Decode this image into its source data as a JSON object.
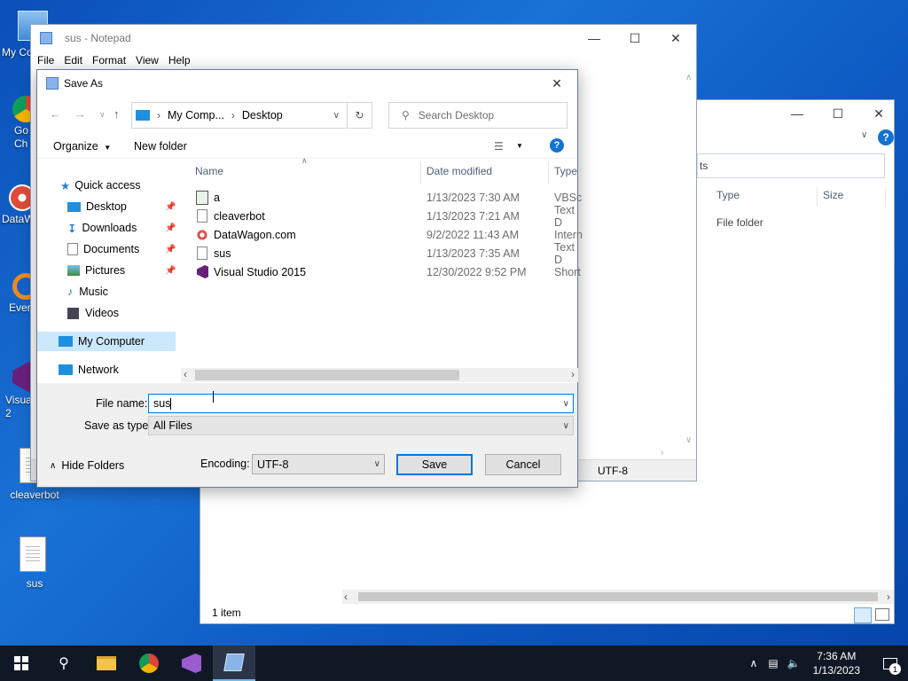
{
  "desktop": {
    "icons": [
      {
        "label": "My Co",
        "icon": "computer-icon"
      },
      {
        "label": "Go\nCh",
        "icon": "chrome-icon"
      },
      {
        "label": "DataW",
        "icon": "datawagon-icon"
      },
      {
        "label": "Ever",
        "icon": "everything-icon"
      },
      {
        "label": "Visua\n2",
        "icon": "visual-studio-icon"
      },
      {
        "label": "cleaverbot",
        "icon": "text-file-icon"
      },
      {
        "label": "sus",
        "icon": "text-file-icon"
      }
    ]
  },
  "explorer_bg": {
    "search_fragment": "ts",
    "col_type": "Type",
    "col_size": "Size",
    "row_type": "File folder",
    "status": "1 item"
  },
  "notepad": {
    "title": "sus - Notepad",
    "menu": [
      "File",
      "Edit",
      "Format",
      "View",
      "Help"
    ],
    "encoding_status": "UTF-8"
  },
  "dialog": {
    "title": "Save As",
    "breadcrumb": [
      "My Comp...",
      "Desktop"
    ],
    "search_placeholder": "Search Desktop",
    "organize": "Organize",
    "new_folder": "New folder",
    "nav": {
      "quick_access": "Quick access",
      "items": [
        {
          "label": "Desktop",
          "icon": "desktop-folder-icon",
          "pinned": true
        },
        {
          "label": "Downloads",
          "icon": "downloads-icon",
          "pinned": true
        },
        {
          "label": "Documents",
          "icon": "documents-icon",
          "pinned": true
        },
        {
          "label": "Pictures",
          "icon": "pictures-icon",
          "pinned": true
        },
        {
          "label": "Music",
          "icon": "music-icon",
          "pinned": false
        },
        {
          "label": "Videos",
          "icon": "videos-icon",
          "pinned": false
        }
      ],
      "my_computer": "My Computer",
      "network": "Network"
    },
    "columns": {
      "name": "Name",
      "date": "Date modified",
      "type": "Type"
    },
    "files": [
      {
        "name": "a",
        "date": "1/13/2023 7:30 AM",
        "type": "VBSc",
        "icon": "vbs-script-icon"
      },
      {
        "name": "cleaverbot",
        "date": "1/13/2023 7:21 AM",
        "type": "Text D",
        "icon": "text-file-icon"
      },
      {
        "name": "DataWagon.com",
        "date": "9/2/2022 11:43 AM",
        "type": "Intern",
        "icon": "internet-shortcut-icon"
      },
      {
        "name": "sus",
        "date": "1/13/2023 7:35 AM",
        "type": "Text D",
        "icon": "text-file-icon"
      },
      {
        "name": "Visual Studio 2015",
        "date": "12/30/2022 9:52 PM",
        "type": "Short",
        "icon": "visual-studio-icon"
      }
    ],
    "file_name_label": "File name:",
    "file_name_value": "sus",
    "save_type_label": "Save as type:",
    "save_type_value": "All Files",
    "hide_folders": "Hide Folders",
    "encoding_label": "Encoding:",
    "encoding_value": "UTF-8",
    "save": "Save",
    "cancel": "Cancel"
  },
  "taskbar": {
    "time": "7:36 AM",
    "date": "1/13/2023",
    "notification_count": "1"
  },
  "colors": {
    "accent": "#0078d7",
    "taskbar": "#101826",
    "selected_nav": "#cce8ff"
  }
}
